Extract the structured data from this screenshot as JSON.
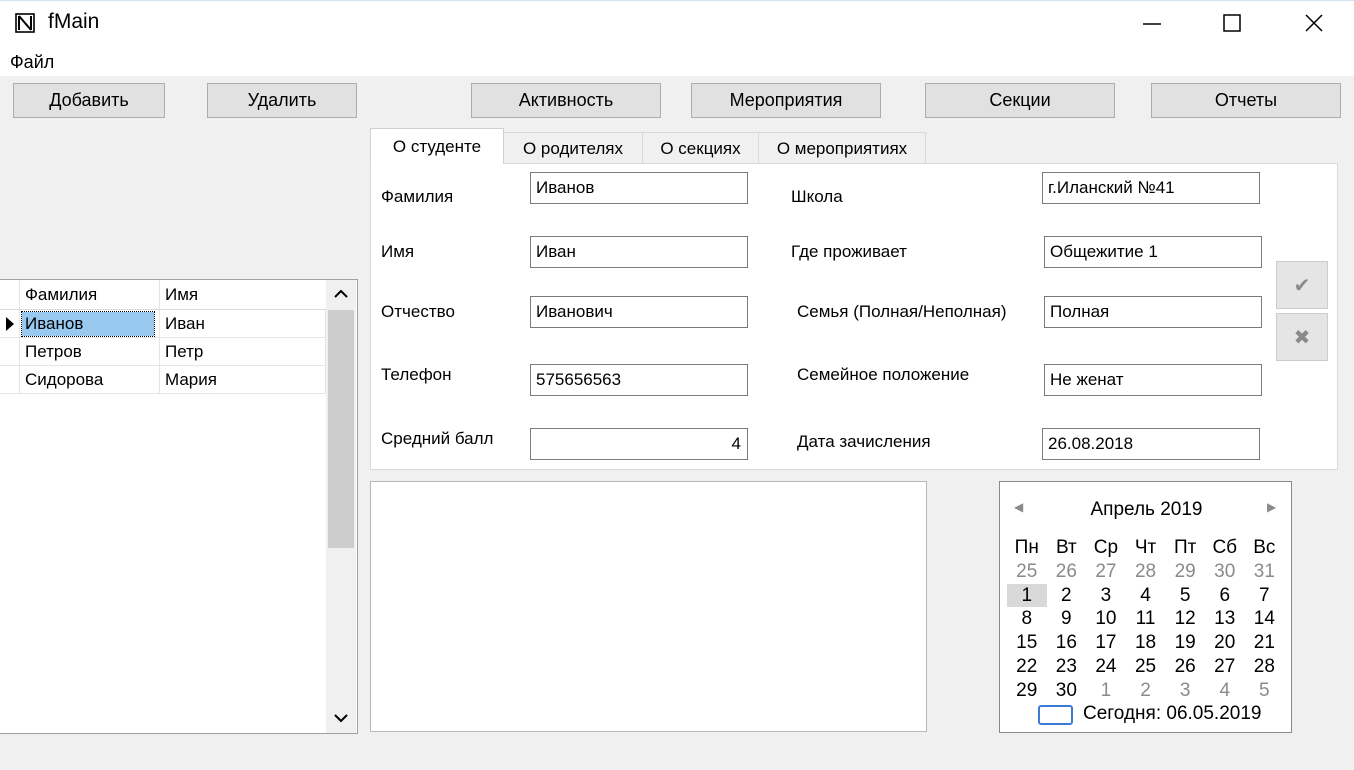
{
  "window": {
    "title": "fMain",
    "controls": [
      "minimize-icon",
      "maximize-icon",
      "close-icon"
    ]
  },
  "menu": {
    "file": "Файл"
  },
  "toolbar": {
    "add": "Добавить",
    "delete": "Удалить",
    "activity": "Активность",
    "events": "Мероприятия",
    "sections": "Секции",
    "reports": "Отчеты"
  },
  "grid": {
    "columns": [
      "Фамилия",
      "Имя"
    ],
    "rows": [
      [
        "Иванов",
        "Иван"
      ],
      [
        "Петров",
        "Петр"
      ],
      [
        "Сидорова",
        "Мария"
      ]
    ],
    "selected_row": 0
  },
  "tabs": [
    "О студенте",
    "О родителях",
    "О секциях",
    "О мероприятиях"
  ],
  "student": {
    "last_name_label": "Фамилия",
    "last_name": "Иванов",
    "first_name_label": "Имя",
    "first_name": "Иван",
    "patronymic_label": "Отчество",
    "patronymic": "Иванович",
    "phone_label": "Телефон",
    "phone": "575656563",
    "avg_label": "Средний балл",
    "avg": "4",
    "school_label": "Школа",
    "school": "г.Иланский №41",
    "residence_label": "Где проживает",
    "residence": "Общежитие 1",
    "family_label": "Семья (Полная/Неполная)",
    "family": "Полная",
    "marital_label": "Семейное положение",
    "marital": "Не женат",
    "enroll_label": "Дата зачисления",
    "enroll": "26.08.2018"
  },
  "side_buttons": {
    "confirm": "✔",
    "cancel": "✖"
  },
  "calendar": {
    "title": "Апрель 2019",
    "weekdays": [
      "Пн",
      "Вт",
      "Ср",
      "Чт",
      "Пт",
      "Сб",
      "Вс"
    ],
    "weeks": [
      [
        "25",
        "26",
        "27",
        "28",
        "29",
        "30",
        "31"
      ],
      [
        "1",
        "2",
        "3",
        "4",
        "5",
        "6",
        "7"
      ],
      [
        "8",
        "9",
        "10",
        "11",
        "12",
        "13",
        "14"
      ],
      [
        "15",
        "16",
        "17",
        "18",
        "19",
        "20",
        "21"
      ],
      [
        "22",
        "23",
        "24",
        "25",
        "26",
        "27",
        "28"
      ],
      [
        "29",
        "30",
        "1",
        "2",
        "3",
        "4",
        "5"
      ]
    ],
    "today": "Сегодня: 06.05.2019"
  }
}
